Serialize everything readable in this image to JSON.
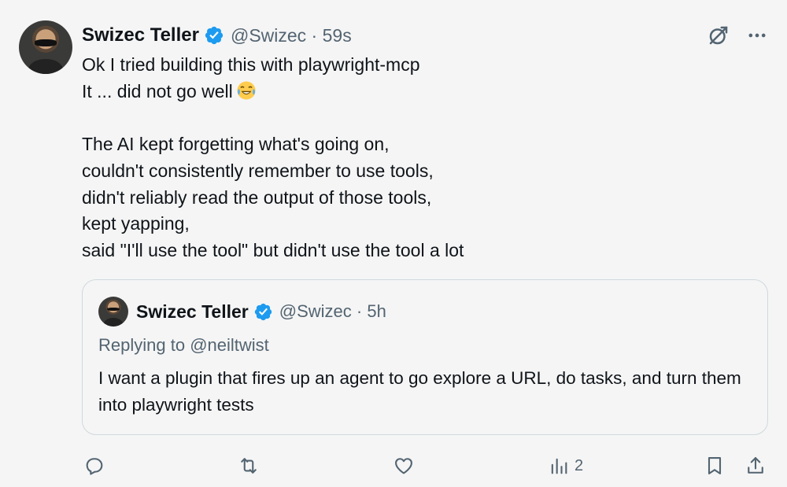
{
  "tweet": {
    "author_name": "Swizec Teller",
    "handle_time": "@Swizec · 59s",
    "lines": [
      "Ok I tried building this with playwright-mcp",
      "It ... did not go well",
      "",
      "The AI kept forgetting what's going on,",
      "couldn't consistently remember to use tools,",
      "didn't reliably read the output of those tools,",
      "kept yapping,",
      "said \"I'll use the tool\" but didn't use the tool a lot"
    ],
    "emoji": "face-with-tears-of-joy-emoji"
  },
  "quote": {
    "author_name": "Swizec Teller",
    "handle_time": "@Swizec · 5h",
    "replying_prefix": "Replying to ",
    "replying_mention": "@neiltwist",
    "text": "I want a plugin that fires up an agent to go explore a URL, do tasks, and turn them into playwright tests"
  },
  "actions": {
    "reply_icon": "reply-icon",
    "retweet_icon": "retweet-icon",
    "like_icon": "like-icon",
    "views_icon": "views-icon",
    "views_count": "2",
    "bookmark_icon": "bookmark-icon",
    "share_icon": "share-icon"
  },
  "top_icons": {
    "grok": "grok-icon",
    "more": "more-icon"
  },
  "colors": {
    "verified": "#1d9bf0",
    "secondary_text": "#536471",
    "border": "#cfd9de",
    "background": "#f5f5f5"
  }
}
